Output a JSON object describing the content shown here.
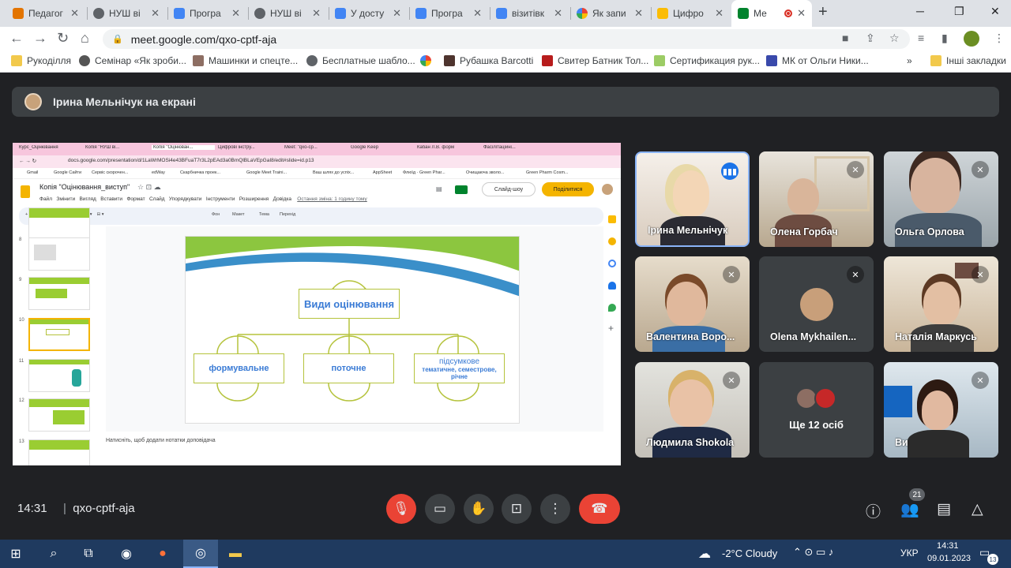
{
  "browser": {
    "tabs": [
      {
        "label": "Педагог",
        "color": "#e37400"
      },
      {
        "label": "НУШ ві",
        "color": "#5f6368"
      },
      {
        "label": "Програ",
        "color": "#4285f4"
      },
      {
        "label": "НУШ ві",
        "color": "#5f6368"
      },
      {
        "label": "У досту",
        "color": "#4285f4"
      },
      {
        "label": "Програ",
        "color": "#4285f4"
      },
      {
        "label": "візитівк",
        "color": "#4285f4"
      },
      {
        "label": "Як запи",
        "color": "#4285f4"
      },
      {
        "label": "Цифро",
        "color": "#fbbc04"
      },
      {
        "label": "Ме",
        "color": "#00832d"
      }
    ],
    "url": "meet.google.com/qxo-cptf-aja",
    "bookmarks": [
      "Рукоділля",
      "Семінар «Як зроби...",
      "Машинки и спецте...",
      "Бесплатные шабло...",
      "Рубашка Barcotti",
      "Свитер Батник Тол...",
      "Сертификация рук...",
      "МК от Ольги Ники..."
    ],
    "other_bookmarks": "Інші закладки"
  },
  "meet": {
    "presenter_label": "Ірина Мельнічук на екрані",
    "time": "14:31",
    "meeting_code": "qxo-cptf-aja",
    "participants_count": "21",
    "more_label": "Ще 12 осіб",
    "tiles": [
      {
        "name": "Ірина Мельнічук"
      },
      {
        "name": "Олена Горбач"
      },
      {
        "name": "Ольга Орлова"
      },
      {
        "name": "Валентина Воро..."
      },
      {
        "name": "Olena Mykhailen..."
      },
      {
        "name": "Наталія Маркусь"
      },
      {
        "name": "Людмила Shokola"
      },
      {
        "name": "Ви"
      }
    ]
  },
  "shared": {
    "inner_tabs": [
      "Курс_Оцінювання",
      "Копія \"НУШ ві...",
      "Копія \"Оцінюван...",
      "Цифрові інстру...",
      "Meet: \"qxo-cp...",
      "Google Keep",
      "Кабан Л.В. форм",
      "Фасілітаційні..."
    ],
    "inner_url": "docs.google.com/presentation/d/1LaWrMOSi4e43BFuaT7r3L2pEAd3a0BmQlBLaVEpGaI8/edit#slide=id.p13",
    "inner_bookmarks": [
      "Gmail",
      "Google Сайти",
      "Сервіс скорочен...",
      "edWay",
      "Скарбничка проек...",
      "Google Meet Traini...",
      "Ваш шлях до успіх...",
      "AppSheet",
      "Флюїд · Green Phar...",
      "Очищаюча зволо...",
      "Green Pharm Cosm..."
    ],
    "doc_title": "Копія \"Оцінювання_виступ\"",
    "menus": [
      "Файл",
      "Змінити",
      "Вигляд",
      "Вставити",
      "Формат",
      "Слайд",
      "Упорядкувати",
      "Інструменти",
      "Розширення",
      "Довідка"
    ],
    "last_edit": "Остання зміна: 1 годину тому",
    "slideshow_label": "Слайд-шоу",
    "share_label": "Поділитися",
    "tool_items": [
      "Фон",
      "Макет",
      "Тема",
      "Перехід"
    ],
    "slide_numbers": [
      "8",
      "9",
      "10",
      "11",
      "12",
      "13"
    ],
    "notes_placeholder": "Натисніть, щоб додати нотатки доповідача",
    "slide": {
      "title": "Види оцінювання",
      "box1": "формувальне",
      "box2": "поточне",
      "box3_title": "підсумкове",
      "box3_sub": "тематичне, семестрове, річне"
    }
  },
  "taskbar": {
    "weather": "-2°C  Cloudy",
    "lang": "УКР",
    "time": "14:31",
    "date": "09.01.2023",
    "notifications": "13"
  }
}
